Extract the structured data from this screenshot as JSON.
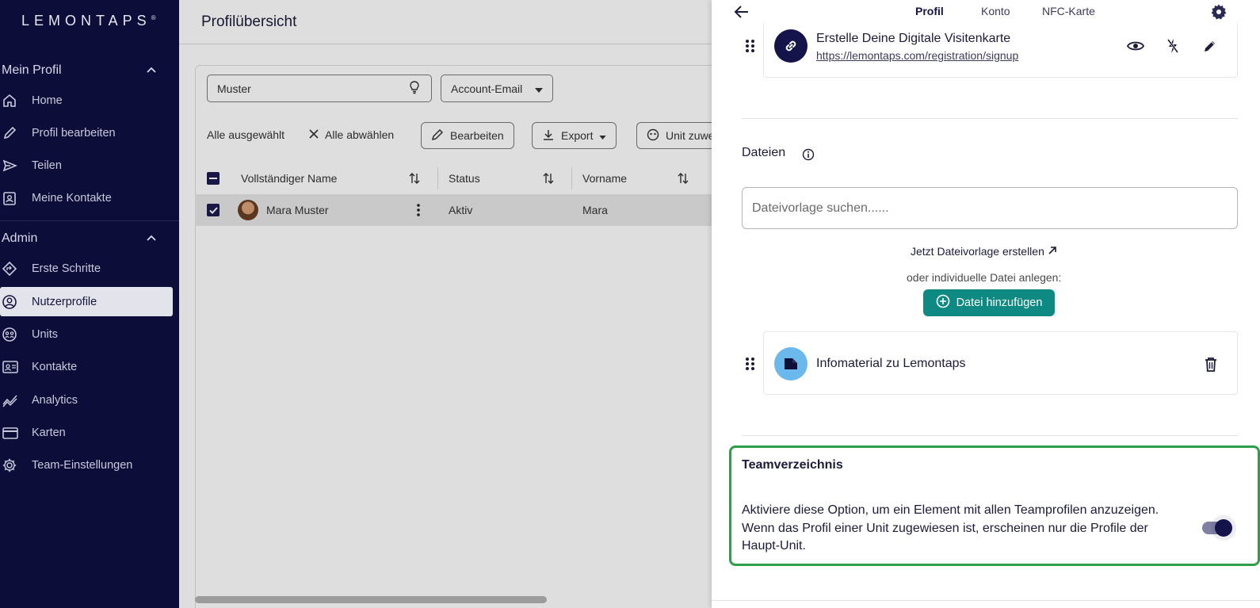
{
  "app": {
    "logo": "LEMONTAPS",
    "logo_mark": "®"
  },
  "sidebar": {
    "profile_section": "Mein Profil",
    "profile_items": [
      {
        "label": "Home",
        "icon": "home-icon"
      },
      {
        "label": "Profil bearbeiten",
        "icon": "pencil-icon"
      },
      {
        "label": "Teilen",
        "icon": "send-icon"
      },
      {
        "label": "Meine Kontakte",
        "icon": "contacts-icon"
      }
    ],
    "admin_section": "Admin",
    "admin_items": [
      {
        "label": "Erste Schritte",
        "icon": "diamond-direction-icon"
      },
      {
        "label": "Nutzerprofile",
        "icon": "user-circle-icon",
        "active": true
      },
      {
        "label": "Units",
        "icon": "units-icon"
      },
      {
        "label": "Kontakte",
        "icon": "contact-card-icon"
      },
      {
        "label": "Analytics",
        "icon": "analytics-icon"
      },
      {
        "label": "Karten",
        "icon": "card-icon"
      },
      {
        "label": "Team-Einstellungen",
        "icon": "gear-icon"
      }
    ]
  },
  "main": {
    "title": "Profilübersicht",
    "search_value": "Muster",
    "filter_select": "Account-Email",
    "selection": {
      "all_selected": "Alle ausgewählt",
      "deselect_all": "Alle abwählen",
      "edit": "Bearbeiten",
      "export": "Export",
      "unit_assign": "Unit zuwe"
    },
    "table": {
      "headers": [
        "Vollständiger Name",
        "Status",
        "Vorname"
      ],
      "rows": [
        {
          "name": "Mara Muster",
          "status": "Aktiv",
          "first_name": "Mara"
        }
      ]
    }
  },
  "drawer": {
    "tabs": [
      "Profil",
      "Konto",
      "NFC-Karte"
    ],
    "active_tab": "Profil",
    "link_card": {
      "title": "Erstelle Deine Digitale Visitenkarte",
      "url": "https://lemontaps.com/registration/signup"
    },
    "files": {
      "title": "Dateien",
      "search_placeholder": "Dateivorlage suchen......",
      "create_template": "Jetzt Dateivorlage erstellen",
      "or_individual": "oder individuelle Datei anlegen:",
      "add_file": "Datei hinzufügen",
      "items": [
        {
          "name": "Infomaterial zu Lemontaps"
        }
      ]
    },
    "team_directory": {
      "title": "Teamverzeichnis",
      "description": "Aktiviere diese Option, um ein Element mit allen Teamprofilen anzuzeigen. Wenn das Profil einer Unit zugewiesen ist, erscheinen nur die Profile der Haupt-Unit.",
      "enabled": true
    }
  },
  "colors": {
    "sidebar_bg": "#0d0d3a",
    "accent": "#14144a",
    "teal_button": "#0e8a83",
    "highlight_border": "#2f9e4a",
    "file_icon_bg": "#6bb8ec"
  }
}
